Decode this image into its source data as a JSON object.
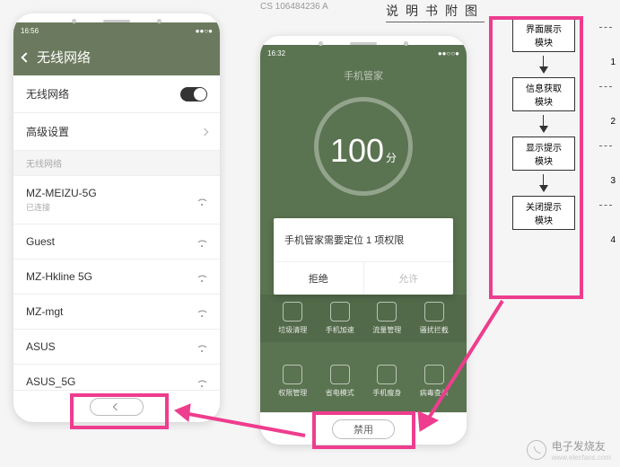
{
  "doc": {
    "header": "CS 106484236 A",
    "title": "说明书附图"
  },
  "colors": {
    "accent": "#ee3d8e",
    "phone_green": "#5a7350",
    "header_green": "#6b7a5e"
  },
  "phone_left": {
    "status": {
      "time": "16:56",
      "icons": "●●○●"
    },
    "header": {
      "title": "无线网络"
    },
    "rows": {
      "wifi_toggle": {
        "label": "无线网络",
        "on": true
      },
      "advanced": {
        "label": "高级设置"
      },
      "section": "无线网络",
      "networks": [
        {
          "ssid": "MZ-MEIZU-5G",
          "sub": "已连接"
        },
        {
          "ssid": "Guest"
        },
        {
          "ssid": "MZ-Hkline 5G"
        },
        {
          "ssid": "MZ-mgt"
        },
        {
          "ssid": "ASUS"
        },
        {
          "ssid": "ASUS_5G"
        }
      ]
    }
  },
  "phone_right": {
    "status": {
      "time": "16:32",
      "icons": "●●○○●"
    },
    "app_title": "手机管家",
    "score": {
      "value": "100",
      "unit": "分"
    },
    "dialog": {
      "message": "手机管家需要定位 1 项权限",
      "deny": "拒绝",
      "allow": "允许"
    },
    "grid_top": [
      "垃圾清理",
      "手机加速",
      "流量管理",
      "骚扰拦截"
    ],
    "grid_bottom": [
      "权限管理",
      "省电模式",
      "手机瘦身",
      "病毒查杀"
    ],
    "home_button": "禁用"
  },
  "flowchart": {
    "boxes": [
      {
        "num": "1",
        "line1": "界面展示",
        "line2": "模块"
      },
      {
        "num": "2",
        "line1": "信息获取",
        "line2": "模块"
      },
      {
        "num": "3",
        "line1": "显示提示",
        "line2": "模块"
      },
      {
        "num": "4",
        "line1": "关闭提示",
        "line2": "模块"
      }
    ]
  },
  "watermark": {
    "name": "电子发烧友",
    "url": "www.elecfans.com"
  }
}
